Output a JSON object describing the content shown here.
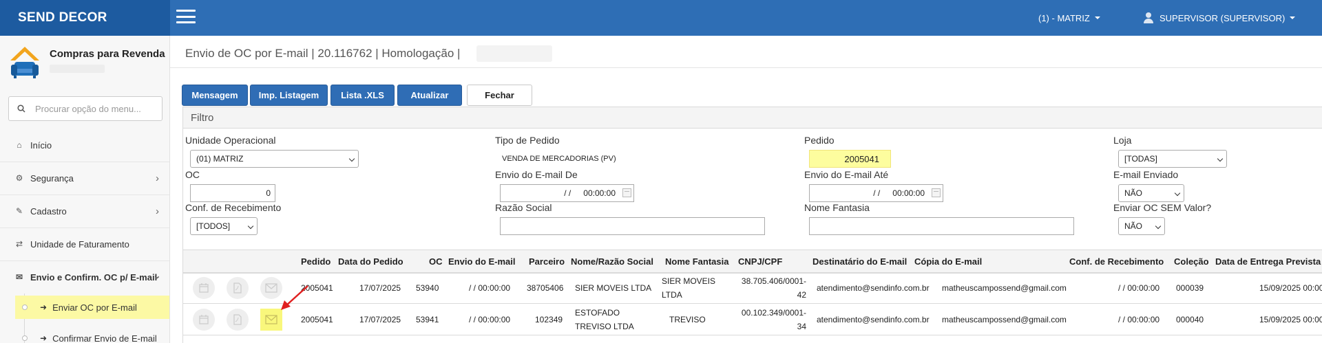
{
  "header": {
    "brand": "SEND DECOR",
    "unit_menu": "(1) - MATRIZ",
    "user_menu": "SUPERVISOR (SUPERVISOR)",
    "colors": {
      "topbar": "#2e6eb5",
      "brand_bg": "#1d5ba0",
      "button": "#2f6db5",
      "highlight": "#fcf9a4"
    }
  },
  "sidebar": {
    "app_name": "Compras para Revenda",
    "search_placeholder": "Procurar opção do menu...",
    "items": [
      {
        "label": "Início",
        "icon": "home-icon"
      },
      {
        "label": "Segurança",
        "icon": "gears-icon"
      },
      {
        "label": "Cadastro",
        "icon": "edit-icon"
      },
      {
        "label": "Unidade de Faturamento",
        "icon": "exchange-icon"
      },
      {
        "label": "Envio e Confirm. OC p/ E-mail",
        "icon": "envelope-icon"
      }
    ],
    "subitems": [
      {
        "label": "Enviar OC por E-mail",
        "icon": "sign-out-icon"
      },
      {
        "label": "Confirmar Envio de E-mail",
        "icon": "sign-in-icon"
      }
    ]
  },
  "page": {
    "title": "Envio de OC por E-mail | 20.116762 | Homologação |",
    "buttons": {
      "mensagem": "Mensagem",
      "imp_listagem": "Imp. Listagem",
      "lista_xls": "Lista .XLS",
      "atualizar": "Atualizar",
      "fechar": "Fechar"
    }
  },
  "filter": {
    "title": "Filtro",
    "unidade_label": "Unidade Operacional",
    "unidade_value": "(01) MATRIZ",
    "tipo_label": "Tipo de Pedido",
    "tipo_value": "VENDA DE MERCADORIAS (PV)",
    "pedido_label": "Pedido",
    "pedido_value": "2005041",
    "loja_label": "Loja",
    "loja_value": "[TODAS]",
    "oc_label": "OC",
    "oc_value": "0",
    "envio_de_label": "Envio do E-mail De",
    "envio_de_date": "/ /",
    "envio_de_time": "00:00:00",
    "envio_ate_label": "Envio do E-mail Até",
    "envio_ate_date": "/ /",
    "envio_ate_time": "00:00:00",
    "email_enviado_label": "E-mail Enviado",
    "email_enviado_value": "NÃO",
    "conf_label": "Conf. de Recebimento",
    "conf_value": "[TODOS]",
    "razao_label": "Razão Social",
    "razao_value": "",
    "fantasia_label": "Nome Fantasia",
    "fantasia_value": "",
    "sem_valor_label": "Enviar OC SEM Valor?",
    "sem_valor_value": "NÃO"
  },
  "grid": {
    "headers": {
      "pedido": "Pedido",
      "data_pedido": "Data do Pedido",
      "oc": "OC",
      "envio": "Envio do E-mail",
      "parceiro": "Parceiro",
      "razao": "Nome/Razão Social",
      "fantasia": "Nome Fantasia",
      "cnpj": "CNPJ/CPF",
      "destinatario": "Destinatário do E-mail",
      "copia": "Cópia do E-mail",
      "conf": "Conf. de Recebimento",
      "colecao": "Coleção",
      "entrega": "Data de Entrega Prevista"
    },
    "rows": [
      {
        "pedido": "2005041",
        "data_pedido": "17/07/2025",
        "oc": "53940",
        "envio": "/ / 00:00:00",
        "parceiro": "38705406",
        "razao": "SIER MOVEIS LTDA",
        "fantasia": "SIER MOVEIS LTDA",
        "cnpj": "38.705.406/0001-42",
        "destinatario": "atendimento@sendinfo.com.br",
        "copia": "matheuscampossend@gmail.com",
        "conf": "/ / 00:00:00",
        "colecao": "000039",
        "entrega": "15/09/2025 00:00"
      },
      {
        "pedido": "2005041",
        "data_pedido": "17/07/2025",
        "oc": "53941",
        "envio": "/ / 00:00:00",
        "parceiro": "102349",
        "razao": "ESTOFADO TREVISO LTDA",
        "fantasia": "TREVISO",
        "cnpj": "00.102.349/0001-34",
        "destinatario": "atendimento@sendinfo.com.br",
        "copia": "matheuscampossend@gmail.com",
        "conf": "/ / 00:00:00",
        "colecao": "000040",
        "entrega": "15/09/2025 00:00"
      }
    ]
  }
}
